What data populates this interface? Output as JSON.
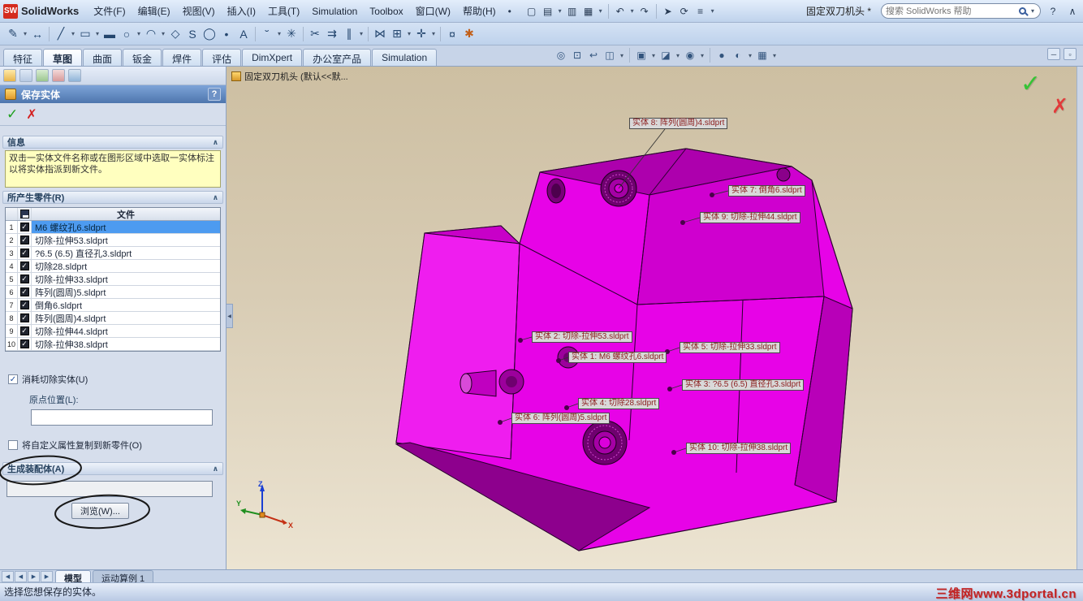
{
  "window": {
    "logo_prefix": "SW",
    "logo_text": "SolidWorks",
    "doc_title": "固定双刀机头 *",
    "search_placeholder": "搜索 SolidWorks 帮助"
  },
  "menubar": {
    "items": [
      "文件(F)",
      "编辑(E)",
      "视图(V)",
      "插入(I)",
      "工具(T)",
      "Simulation",
      "Toolbox",
      "窗口(W)",
      "帮助(H)"
    ]
  },
  "command_tabs": {
    "items": [
      {
        "label": "特征"
      },
      {
        "label": "草图"
      },
      {
        "label": "曲面"
      },
      {
        "label": "钣金"
      },
      {
        "label": "焊件"
      },
      {
        "label": "评估"
      },
      {
        "label": "DimXpert"
      },
      {
        "label": "办公室产品"
      },
      {
        "label": "Simulation"
      }
    ]
  },
  "property_manager": {
    "title": "保存实体",
    "help": "?",
    "info": {
      "header": "信息",
      "message": "双击一实体文件名称或在图形区域中选取一实体标注以将实体指派到新文件。"
    },
    "parts": {
      "header": "所产生零件(R)",
      "column_file": "文件",
      "rows": [
        {
          "num": "1",
          "file": "M6 螺纹孔6.sldprt"
        },
        {
          "num": "2",
          "file": "切除-拉伸53.sldprt"
        },
        {
          "num": "3",
          "file": "?6.5 (6.5) 直径孔3.sldprt"
        },
        {
          "num": "4",
          "file": "切除28.sldprt"
        },
        {
          "num": "5",
          "file": "切除-拉伸33.sldprt"
        },
        {
          "num": "6",
          "file": "阵列(圆周)5.sldprt"
        },
        {
          "num": "7",
          "file": "倒角6.sldprt"
        },
        {
          "num": "8",
          "file": "阵列(圆周)4.sldprt"
        },
        {
          "num": "9",
          "file": "切除-拉伸44.sldprt"
        },
        {
          "num": "10",
          "file": "切除-拉伸38.sldprt"
        }
      ]
    },
    "consume_checkbox_label": "消耗切除实体(U)",
    "origin_label": "原点位置(L):",
    "origin_value": "",
    "copy_props_label": "将自定义属性复制到新零件(O)",
    "assembly": {
      "header": "生成装配体(A)",
      "path_value": "",
      "browse_button": "浏览(W)..."
    }
  },
  "viewport": {
    "config_label": "固定双刀机头 (默认<<默...",
    "triad": {
      "x": "X",
      "y": "Y",
      "z": "Z"
    }
  },
  "callouts": [
    {
      "label": "实体 8:  阵列(圆周)4.sldprt"
    },
    {
      "label": "实体 7:  倒角6.sldprt"
    },
    {
      "label": "实体 9:  切除-拉伸44.sldprt"
    },
    {
      "label": "实体 2:  切除-拉伸53.sldprt"
    },
    {
      "label": "实体 5:  切除-拉伸33.sldprt"
    },
    {
      "label": "实体 1:  M6 螺纹孔6.sldprt"
    },
    {
      "label": "实体 3:  ?6.5 (6.5) 直径孔3.sldprt"
    },
    {
      "label": "实体 4:  切除28.sldprt"
    },
    {
      "label": "实体 6:  阵列(圆周)5.sldprt"
    },
    {
      "label": "实体 10:  切除-拉伸38.sldprt"
    }
  ],
  "bottom": {
    "tabs": [
      "模型",
      "运动算例 1"
    ],
    "status": "选择您想保存的实体。",
    "watermark": "三维网www.3dportal.cn"
  },
  "colors": {
    "model_bright": "#e703e7",
    "model_mid": "#cf00cf",
    "model_dark": "#ad00ad",
    "selection": "#4d9bf0",
    "callout_text": "#8b1d1d"
  },
  "icons": {
    "check": "✓",
    "cross": "✗",
    "chevron_up": "∧",
    "dropdown": "▾",
    "question": "?",
    "minimize": "─",
    "restore": "▫",
    "nav_prev": "◀",
    "nav_next": "▶",
    "collapse_left": "◀",
    "pencil": "✎",
    "dimension": "↔",
    "line": "╱",
    "rect": "▭",
    "slot": "▬",
    "circle": "○",
    "arc": "◠",
    "polygon": "◇",
    "spline": "S",
    "ellipse": "◯",
    "fillet": "˘",
    "text": "A",
    "point": "•",
    "trim": "✂",
    "convert": "⇉",
    "offset": "∥",
    "mirror": "⋈",
    "pattern": "⊞",
    "move": "✛",
    "construction": "✳",
    "snap": "¤",
    "new_doc": "▢",
    "open": "▤",
    "save": "▥",
    "print": "▦",
    "undo": "↶",
    "redo": "↷",
    "select": "➤",
    "rebuild": "⟳",
    "options": "≡",
    "zoom_fit": "◎",
    "zoom_area": "⊡",
    "prev_view": "↩",
    "section": "◫",
    "orientation": "▣",
    "display_style": "◪",
    "hide_show": "◉",
    "appearance": "●",
    "scene": "◐",
    "camera": "▦",
    "star": "✱"
  }
}
